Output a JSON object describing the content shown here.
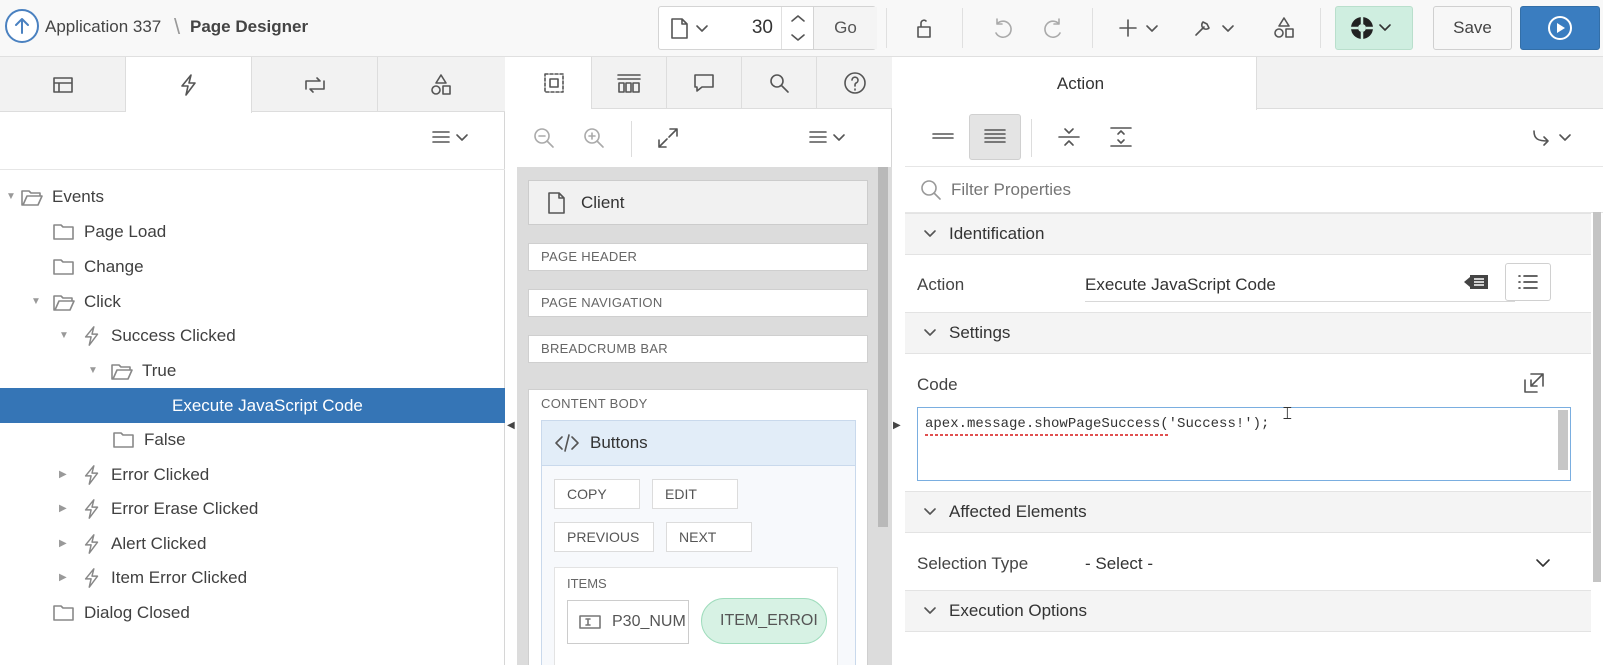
{
  "header": {
    "app_name": "Application 337",
    "separator": "\\",
    "page_title": "Page Designer",
    "page_number": "30",
    "go_label": "Go",
    "save_label": "Save"
  },
  "left_pane": {
    "tabs": [
      "rendering-tab",
      "dynamic-actions-tab",
      "processing-tab",
      "shared-components-tab"
    ],
    "active_tab": "dynamic-actions-tab",
    "tree": [
      {
        "label": "Events",
        "level": 0,
        "icon": "folder-open-icon",
        "expanded": true
      },
      {
        "label": "Page Load",
        "level": 1,
        "icon": "folder-icon"
      },
      {
        "label": "Change",
        "level": 1,
        "icon": "folder-icon"
      },
      {
        "label": "Click",
        "level": 1,
        "icon": "folder-open-icon",
        "expanded": true
      },
      {
        "label": "Success Clicked",
        "level": 2,
        "icon": "lightning-icon",
        "expanded": true
      },
      {
        "label": "True",
        "level": 3,
        "icon": "folder-open-icon",
        "expanded": true
      },
      {
        "label": "Execute JavaScript Code",
        "level": 4,
        "selected": true
      },
      {
        "label": "False",
        "level": 3,
        "icon": "folder-icon"
      },
      {
        "label": "Error Clicked",
        "level": 2,
        "icon": "lightning-icon"
      },
      {
        "label": "Error Erase Clicked",
        "level": 2,
        "icon": "lightning-icon"
      },
      {
        "label": "Alert Clicked",
        "level": 2,
        "icon": "lightning-icon"
      },
      {
        "label": "Item Error Clicked",
        "level": 2,
        "icon": "lightning-icon"
      },
      {
        "label": "Dialog Closed",
        "level": 1,
        "icon": "folder-icon"
      }
    ]
  },
  "middle_pane": {
    "client_label": "Client",
    "regions": [
      "PAGE HEADER",
      "PAGE NAVIGATION",
      "BREADCRUMB BAR"
    ],
    "content_body_label": "CONTENT BODY",
    "buttons_region_label": "Buttons",
    "buttons": [
      "COPY",
      "EDIT",
      "PREVIOUS",
      "NEXT"
    ],
    "items_label": "ITEMS",
    "items": [
      "P30_NUM",
      "ITEM_ERROI"
    ]
  },
  "right_pane": {
    "tab_label": "Action",
    "filter_placeholder": "Filter Properties",
    "groups": {
      "identification": "Identification",
      "settings": "Settings",
      "affected_elements": "Affected Elements",
      "execution_options": "Execution Options"
    },
    "action_label": "Action",
    "action_value": "Execute JavaScript Code",
    "code_label": "Code",
    "code_value": "apex.message.showPageSuccess('Success!');",
    "selection_type_label": "Selection Type",
    "selection_type_value": "- Select -"
  },
  "colors": {
    "accent_blue": "#3575b6",
    "run_button": "#3a7dc0",
    "dev_toolbar_green": "#cfeee0",
    "item_error_green": "#d7f2e4"
  }
}
